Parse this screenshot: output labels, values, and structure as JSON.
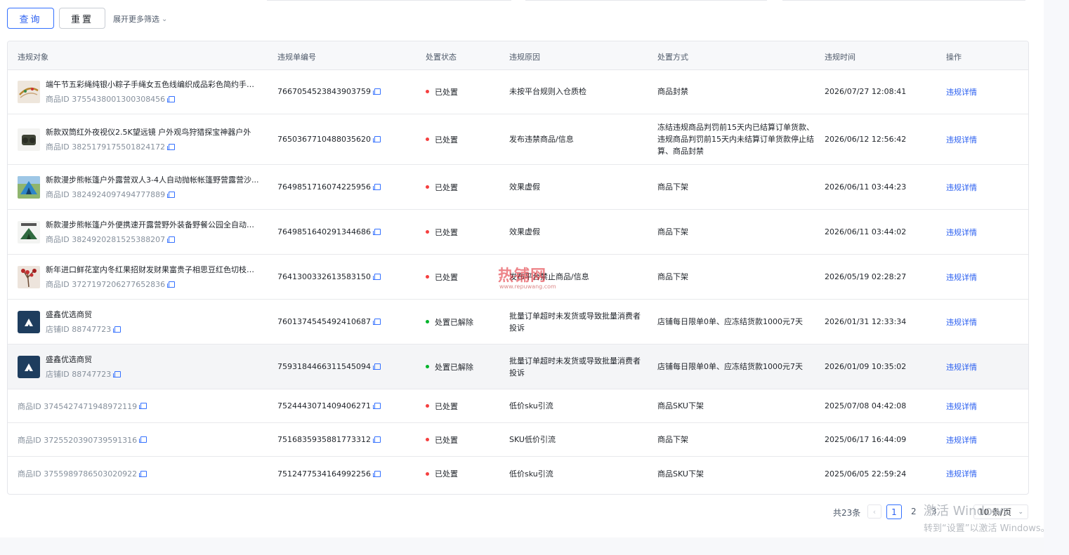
{
  "toolbar": {
    "query_label": "查询",
    "reset_label": "重置",
    "more_filters_label": "展开更多筛选"
  },
  "table": {
    "columns": [
      "违规对象",
      "违规单编号",
      "处置状态",
      "违规原因",
      "处置方式",
      "违规时间",
      "操作"
    ],
    "rows": [
      {
        "title": "端午节五彩绳纯银小粽子手绳女五色线编织成品彩色简约手饰...",
        "id_label": "商品ID 3755438001300308456",
        "ticket": "7667054523843903759",
        "status": "已处置",
        "status_color": "#f53f3f",
        "reason": "未按平台规则入仓质检",
        "method": "商品封禁",
        "time": "2026/07/27 12:08:41",
        "action": "违规详情",
        "thumb": "bracelet"
      },
      {
        "title": "新款双筒红外夜视仪2.5K望远镜 户外观鸟狩猎探宝神器户外",
        "id_label": "商品ID 3825179175501824172",
        "ticket": "7650367710488035620",
        "status": "已处置",
        "status_color": "#f53f3f",
        "reason": "发布违禁商品/信息",
        "method": "冻结违规商品判罚前15天内已结算订单货款、违规商品判罚前15天内未结算订单货款停止结算、商品封禁",
        "time": "2026/06/12 12:56:42",
        "action": "违规详情",
        "thumb": "binocular"
      },
      {
        "title": "新款漫步熊帐篷户外露营双人3-4人自动抛帐帐篷野营露营沙...",
        "id_label": "商品ID 3824924097494777889",
        "ticket": "7649851716074225956",
        "status": "已处置",
        "status_color": "#f53f3f",
        "reason": "效果虚假",
        "method": "商品下架",
        "time": "2026/06/11 03:44:23",
        "action": "违规详情",
        "thumb": "tent-blue"
      },
      {
        "title": "新款漫步熊帐篷户外便携速开露营野外装备野餐公园全自动加...",
        "id_label": "商品ID 3824920281525388207",
        "ticket": "7649851640291344686",
        "status": "已处置",
        "status_color": "#f53f3f",
        "reason": "效果虚假",
        "method": "商品下架",
        "time": "2026/06/11 03:44:02",
        "action": "违规详情",
        "thumb": "tent-green"
      },
      {
        "title": "新年进口鲜花室内冬红果招财发财果富贵子相思豆红色切枝花...",
        "id_label": "商品ID 3727197206277652836",
        "ticket": "7641300332613583150",
        "status": "已处置",
        "status_color": "#f53f3f",
        "reason": "发布平台禁止商品/信息",
        "method": "商品下架",
        "time": "2026/05/19 02:28:27",
        "action": "违规详情",
        "thumb": "flower"
      },
      {
        "title": "盛鑫优选商贸",
        "id_label": "店铺ID 88747723",
        "ticket": "7601374545492410687",
        "status": "处置已解除",
        "status_color": "#00b42a",
        "reason": "批量订单超时未发货或导致批量消费者投诉",
        "method": "店铺每日限单0单、应冻结货款1000元7天",
        "time": "2026/01/31 12:33:34",
        "action": "违规详情",
        "thumb": "shop"
      },
      {
        "title": "盛鑫优选商贸",
        "id_label": "店铺ID 88747723",
        "ticket": "7593184466311545094",
        "status": "处置已解除",
        "status_color": "#00b42a",
        "reason": "批量订单超时未发货或导致批量消费者投诉",
        "method": "店铺每日限单0单、应冻结货款1000元7天",
        "time": "2026/01/09 10:35:02",
        "action": "违规详情",
        "thumb": "shop"
      },
      {
        "title": "",
        "id_label": "商品ID 3745427471948972119",
        "ticket": "7524443071409406271",
        "status": "已处置",
        "status_color": "#f53f3f",
        "reason": "低价sku引流",
        "method": "商品SKU下架",
        "time": "2025/07/08 04:42:08",
        "action": "违规详情",
        "thumb": ""
      },
      {
        "title": "",
        "id_label": "商品ID 3725520390739591316",
        "ticket": "7516835935881773312",
        "status": "已处置",
        "status_color": "#f53f3f",
        "reason": "SKU低价引流",
        "method": "商品下架",
        "time": "2025/06/17 16:44:09",
        "action": "违规详情",
        "thumb": ""
      },
      {
        "title": "",
        "id_label": "商品ID 3755989786503020922",
        "ticket": "7512477534164992256",
        "status": "已处置",
        "status_color": "#f53f3f",
        "reason": "低价sku引流",
        "method": "商品SKU下架",
        "time": "2025/06/05 22:59:24",
        "action": "违规详情",
        "thumb": ""
      }
    ]
  },
  "pagination": {
    "total": "共23条",
    "prev": "‹",
    "current": "1",
    "page2": "2",
    "page3": "3",
    "page_size": "10 条/页"
  },
  "watermark": {
    "main": "热铺网",
    "sub": "www.repuwang.com"
  },
  "os_overlay": {
    "line1": "激活 Windows",
    "line2": "转到“设置”以激活 Windows。"
  },
  "colors": {
    "accent": "#3370ff",
    "danger": "#f53f3f",
    "success": "#00b42a"
  }
}
